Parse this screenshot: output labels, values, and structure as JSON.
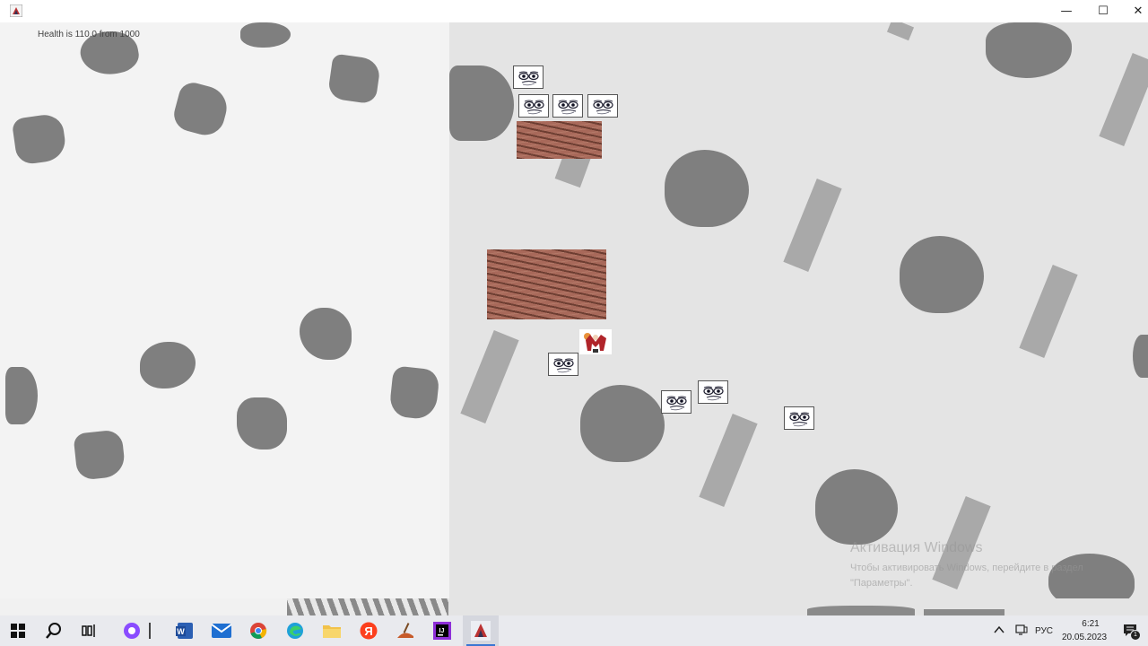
{
  "window": {
    "minimize_glyph": "—",
    "maximize_glyph": "☐",
    "close_glyph": "✕"
  },
  "hud": {
    "health_text": "Health is 110.0 from 1000"
  },
  "watermark": {
    "title": "Активация Windows",
    "line1": "Чтобы активировать Windows, перейдите в раздел",
    "line2": "\"Параметры\"."
  },
  "taskbar": {
    "apps": [
      "start-icon",
      "search-icon",
      "task-view-icon",
      "alice-icon",
      "word-icon",
      "mail-icon",
      "chrome-icon",
      "edge-icon",
      "explorer-icon",
      "yandex-icon",
      "paint-icon",
      "intellij-icon",
      "java-app-icon"
    ],
    "tray": {
      "language": "РУС",
      "time": "6:21",
      "date": "20.05.2023",
      "notification_count": "1"
    }
  },
  "colors": {
    "dirt": "#a8695a",
    "blob": "#7f7f7f",
    "plank": "#a9a9a9",
    "accent": "#3a76d2"
  }
}
